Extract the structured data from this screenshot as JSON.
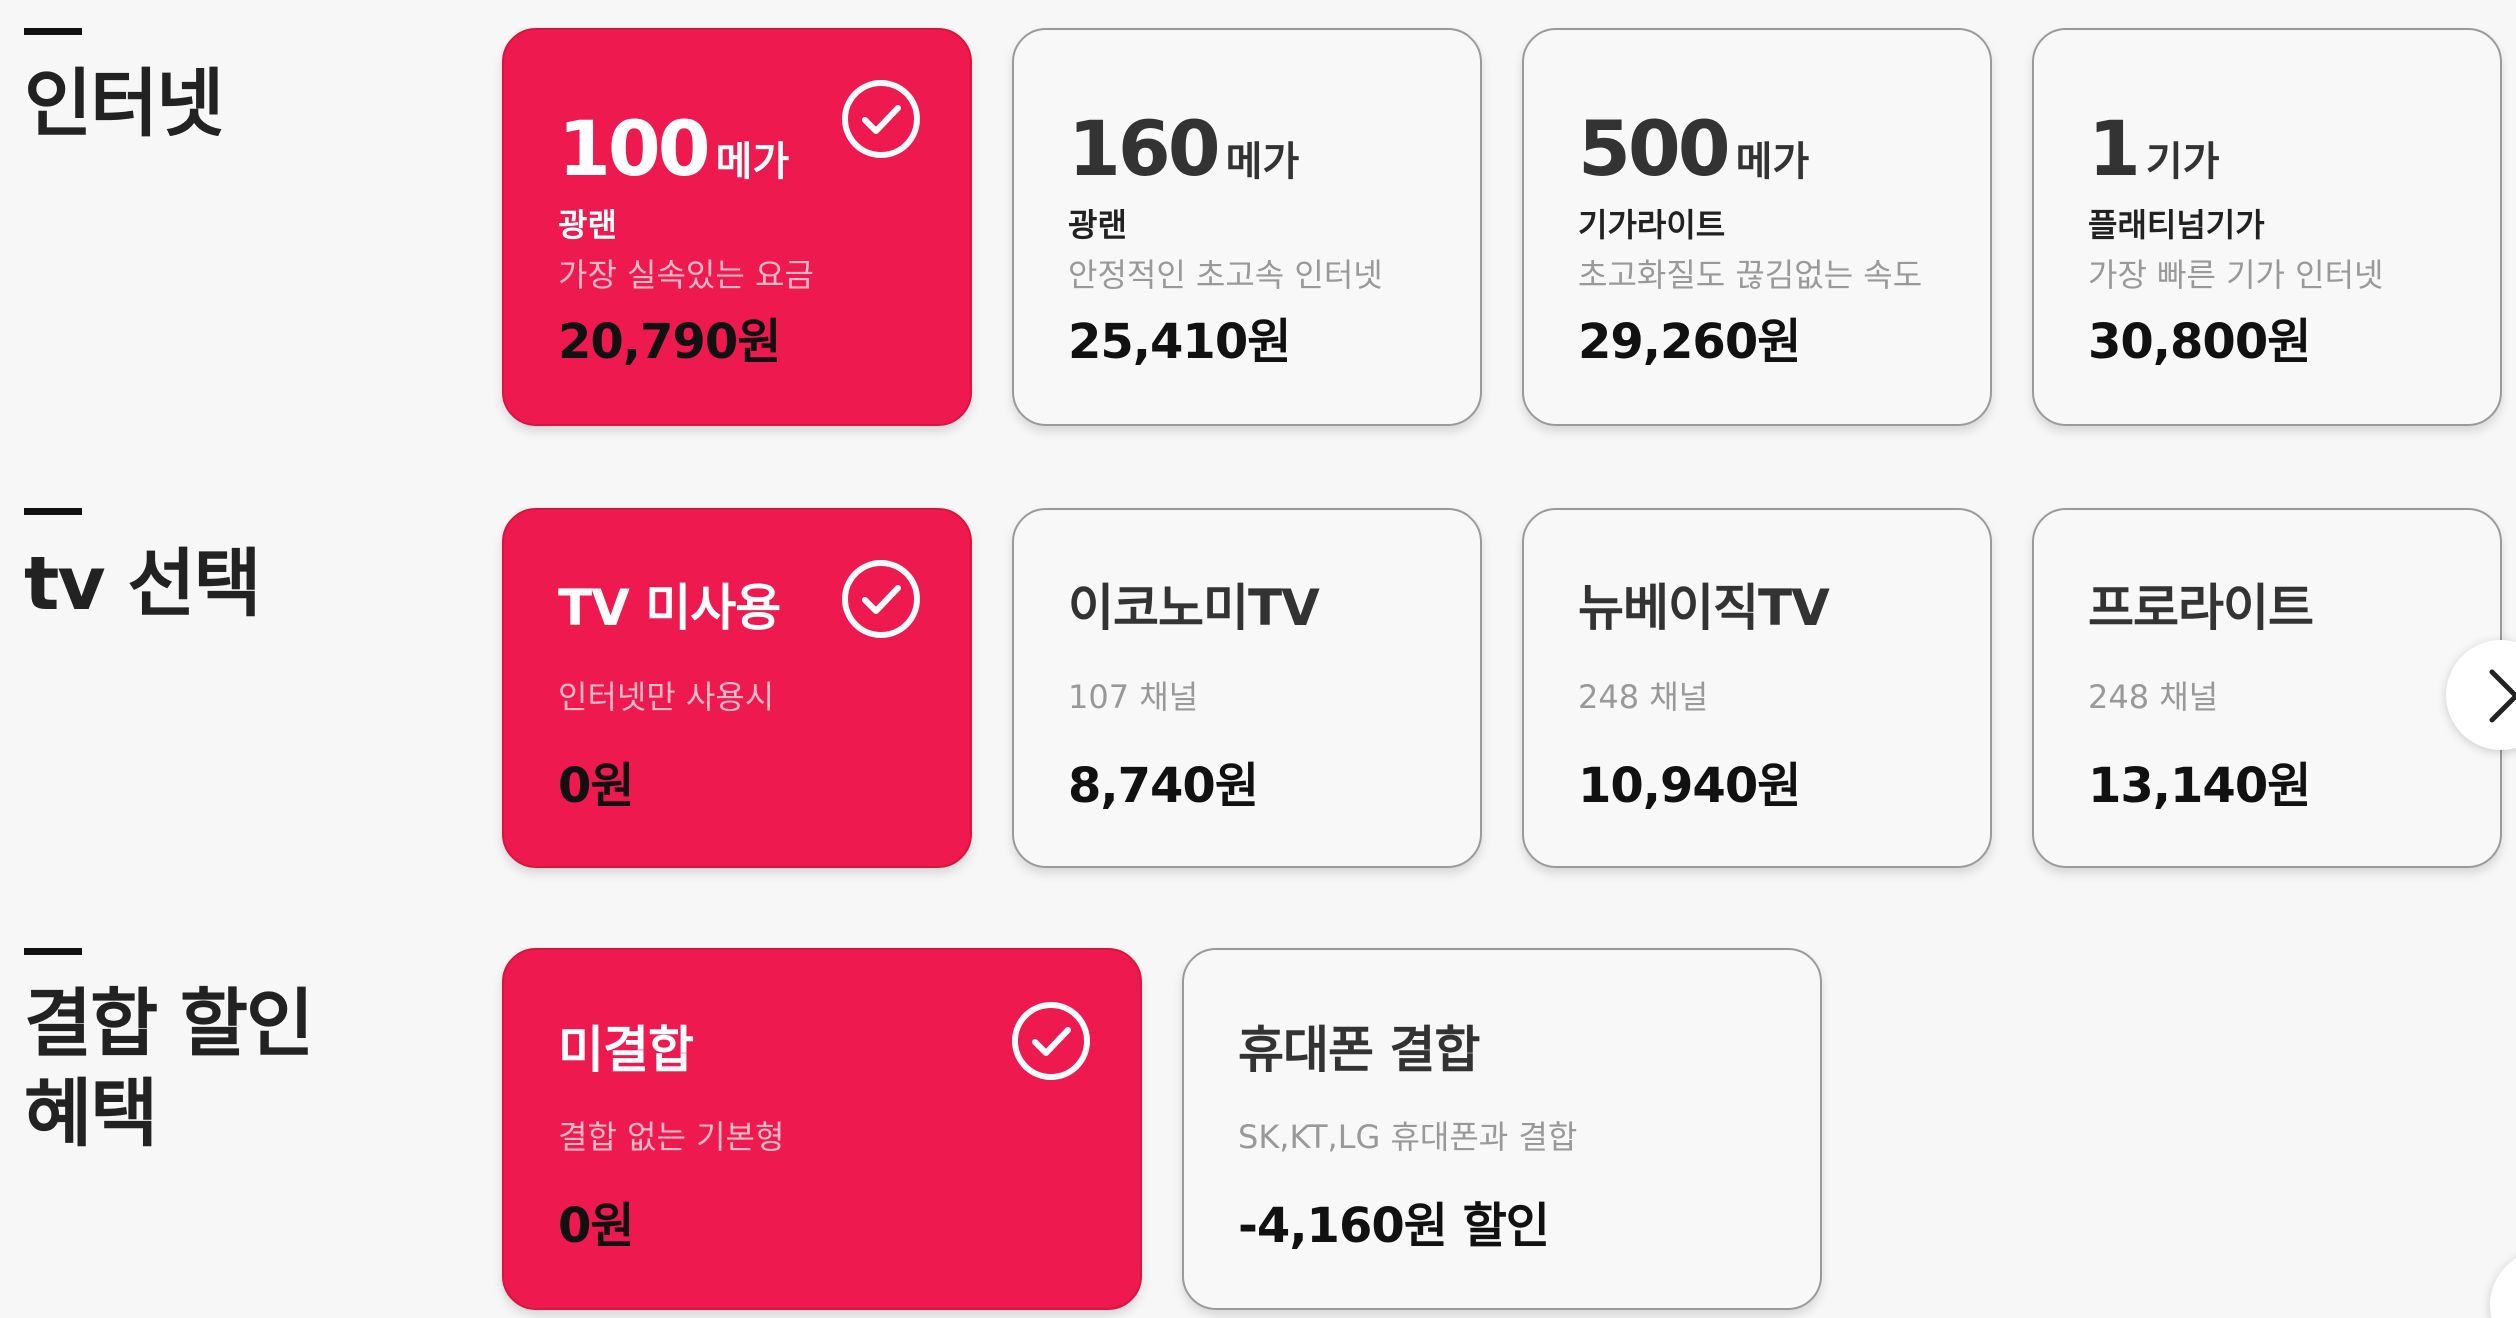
{
  "sections": {
    "internet": {
      "title": "인터넷",
      "cards": [
        {
          "speed": "100",
          "unit": "메가",
          "name": "광랜",
          "desc": "가장 실속있는 요금",
          "price": "20,790원",
          "selected": true
        },
        {
          "speed": "160",
          "unit": "메가",
          "name": "광랜",
          "desc": "안정적인 초고속 인터넷",
          "price": "25,410원",
          "selected": false
        },
        {
          "speed": "500",
          "unit": "메가",
          "name": "기가라이트",
          "desc": "초고화질도 끊김없는 속도",
          "price": "29,260원",
          "selected": false
        },
        {
          "speed": "1",
          "unit": "기가",
          "name": "플래티넘기가",
          "desc": "가장 빠른 기가 인터넷",
          "price": "30,800원",
          "selected": false
        }
      ]
    },
    "tv": {
      "title": "tv 선택",
      "cards": [
        {
          "name": "TV 미사용",
          "desc": "인터넷만 사용시",
          "price": "0원",
          "selected": true
        },
        {
          "name": "이코노미TV",
          "desc": "107 채널",
          "price": "8,740원",
          "selected": false
        },
        {
          "name": "뉴베이직TV",
          "desc": "248 채널",
          "price": "10,940원",
          "selected": false
        },
        {
          "name": "프로라이트",
          "desc": "248 채널",
          "price": "13,140원",
          "selected": false
        }
      ]
    },
    "bundle": {
      "title_line1": "결합 할인",
      "title_line2": "혜택",
      "cards": [
        {
          "name": "미결합",
          "desc": "결합 없는 기본형",
          "price": "0원",
          "selected": true
        },
        {
          "name": "휴대폰 결합",
          "desc": "SK,KT,LG 휴대폰과 결합",
          "price": "-4,160원 할인",
          "selected": false
        }
      ]
    }
  },
  "icons": {
    "check": "check-circle-icon",
    "next": "chevron-right-icon"
  },
  "colors": {
    "selected_bg": "#ee1a4f",
    "card_bg": "#f8f8f8",
    "border": "#9a9a9a"
  }
}
